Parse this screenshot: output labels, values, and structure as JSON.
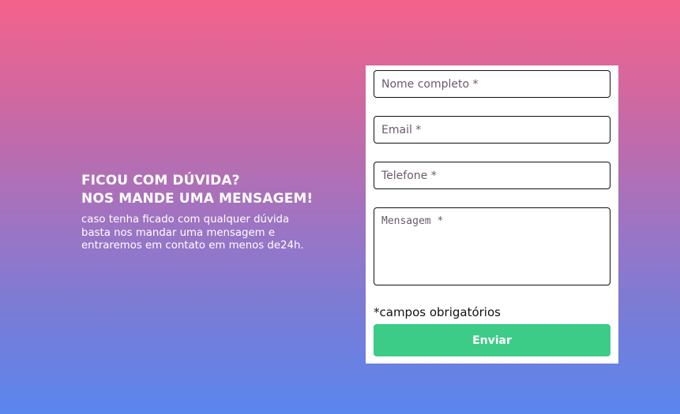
{
  "intro": {
    "title_line1": "FICOU COM DÚVIDA?",
    "title_line2": "NOS MANDE UMA MENSAGEM!",
    "description": "caso tenha ficado com qualquer dúvida basta nos mandar uma mensagem e entraremos em contato em menos de24h."
  },
  "form": {
    "name_placeholder": "Nome completo *",
    "email_placeholder": "Email *",
    "phone_placeholder": "Telefone *",
    "message_placeholder": "Mensagem *",
    "required_note": "*campos obrigatórios",
    "submit_label": "Enviar"
  },
  "colors": {
    "gradient_top": "#f4628a",
    "gradient_bottom": "#5a86ee",
    "submit_button": "#3ccc88",
    "card_background": "#ffffff"
  }
}
